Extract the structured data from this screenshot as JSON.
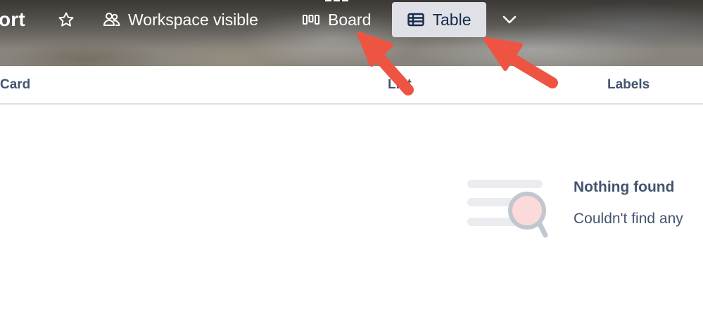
{
  "header": {
    "board_title": "ort",
    "star_icon": "star-icon",
    "visibility": {
      "icon": "people-icon",
      "label": "Workspace visible"
    },
    "views": [
      {
        "icon": "board-icon",
        "label": "Board",
        "active": false
      },
      {
        "icon": "table-icon",
        "label": "Table",
        "active": true
      }
    ],
    "more_views_icon": "chevron-down-icon"
  },
  "table": {
    "columns": [
      "Card",
      "List",
      "Labels"
    ]
  },
  "empty_state": {
    "icon": "search-list-illustration",
    "title": "Nothing found",
    "description": "Couldn't find any"
  },
  "colors": {
    "active_tab_bg": "#dfe1e6",
    "text_dark": "#172b4d",
    "text_muted": "#44546f",
    "annotation_arrow": "#ee5442"
  }
}
